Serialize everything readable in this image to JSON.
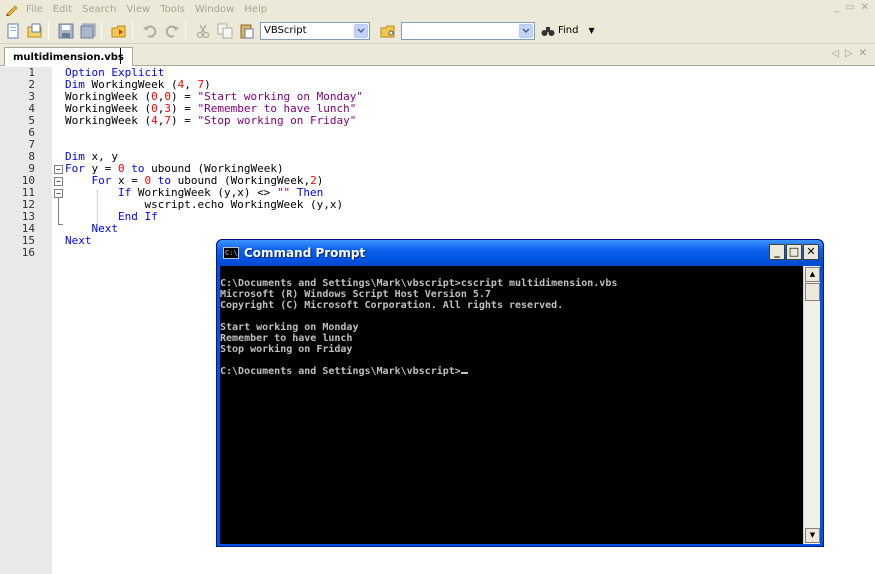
{
  "menubar": {
    "items": [
      "File",
      "Edit",
      "Search",
      "View",
      "Tools",
      "Window",
      "Help"
    ]
  },
  "toolbar": {
    "language_value": "VBScript",
    "find_label": "Find"
  },
  "tab": {
    "filename": "multidimension.vbs"
  },
  "editor": {
    "line_numbers": [
      "1",
      "2",
      "3",
      "4",
      "5",
      "6",
      "7",
      "8",
      "9",
      "10",
      "11",
      "12",
      "13",
      "14",
      "15",
      "16"
    ],
    "lines": [
      [
        {
          "t": "Option Explicit",
          "c": "kw"
        }
      ],
      [
        {
          "t": "Dim",
          "c": "kw"
        },
        {
          "t": " WorkingWeek (",
          "c": "op"
        },
        {
          "t": "4",
          "c": "num"
        },
        {
          "t": ", ",
          "c": "op"
        },
        {
          "t": "7",
          "c": "num"
        },
        {
          "t": ")",
          "c": "op"
        }
      ],
      [
        {
          "t": "WorkingWeek (",
          "c": "op"
        },
        {
          "t": "0",
          "c": "num"
        },
        {
          "t": ",",
          "c": "op"
        },
        {
          "t": "0",
          "c": "num"
        },
        {
          "t": ") = ",
          "c": "op"
        },
        {
          "t": "\"Start working on Monday\"",
          "c": "str"
        }
      ],
      [
        {
          "t": "WorkingWeek (",
          "c": "op"
        },
        {
          "t": "0",
          "c": "num"
        },
        {
          "t": ",",
          "c": "op"
        },
        {
          "t": "3",
          "c": "num"
        },
        {
          "t": ") = ",
          "c": "op"
        },
        {
          "t": "\"Remember to have lunch\"",
          "c": "str"
        }
      ],
      [
        {
          "t": "WorkingWeek (",
          "c": "op"
        },
        {
          "t": "4",
          "c": "num"
        },
        {
          "t": ",",
          "c": "op"
        },
        {
          "t": "7",
          "c": "num"
        },
        {
          "t": ") = ",
          "c": "op"
        },
        {
          "t": "\"Stop working on Friday\"",
          "c": "str"
        }
      ],
      [],
      [],
      [
        {
          "t": "Dim",
          "c": "kw"
        },
        {
          "t": " x, y",
          "c": "op"
        }
      ],
      [
        {
          "t": "For",
          "c": "kw"
        },
        {
          "t": " y = ",
          "c": "op"
        },
        {
          "t": "0",
          "c": "num"
        },
        {
          "t": " ",
          "c": "op"
        },
        {
          "t": "to",
          "c": "kw"
        },
        {
          "t": " ubound (WorkingWeek)",
          "c": "op"
        }
      ],
      [
        {
          "t": "    ",
          "c": "op"
        },
        {
          "t": "For",
          "c": "kw"
        },
        {
          "t": " x = ",
          "c": "op"
        },
        {
          "t": "0",
          "c": "num"
        },
        {
          "t": " ",
          "c": "op"
        },
        {
          "t": "to",
          "c": "kw"
        },
        {
          "t": " ubound (WorkingWeek,",
          "c": "op"
        },
        {
          "t": "2",
          "c": "num"
        },
        {
          "t": ")",
          "c": "op"
        }
      ],
      [
        {
          "t": "        ",
          "c": "op"
        },
        {
          "t": "If",
          "c": "kw"
        },
        {
          "t": " WorkingWeek (y,x) <> ",
          "c": "op"
        },
        {
          "t": "\"\"",
          "c": "str"
        },
        {
          "t": " ",
          "c": "op"
        },
        {
          "t": "Then",
          "c": "kw"
        }
      ],
      [
        {
          "t": "            wscript.echo WorkingWeek (y,x)",
          "c": "op"
        }
      ],
      [
        {
          "t": "        ",
          "c": "op"
        },
        {
          "t": "End If",
          "c": "kw"
        }
      ],
      [
        {
          "t": "    ",
          "c": "op"
        },
        {
          "t": "Next",
          "c": "kw"
        }
      ],
      [
        {
          "t": "Next",
          "c": "kw"
        }
      ],
      []
    ]
  },
  "cmd": {
    "title": "Command Prompt",
    "icon_text": "C:\\",
    "output_lines": [
      "C:\\Documents and Settings\\Mark\\vbscript>cscript multidimension.vbs",
      "Microsoft (R) Windows Script Host Version 5.7",
      "Copyright (C) Microsoft Corporation. All rights reserved.",
      "",
      "Start working on Monday",
      "Remember to have lunch",
      "Stop working on Friday",
      "",
      "C:\\Documents and Settings\\Mark\\vbscript>"
    ]
  }
}
